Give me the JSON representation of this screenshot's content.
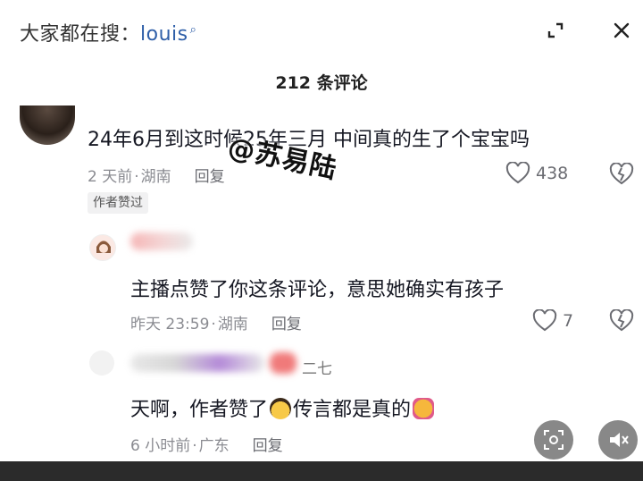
{
  "header": {
    "search_prefix": "大家都在搜：",
    "search_keyword": "louis",
    "expand_icon": "expand-icon",
    "close_icon": "close-icon"
  },
  "comments_title": "212 条评论",
  "comments": [
    {
      "text": "24年6月到这时候25年三月  中间真的生了个宝宝吗",
      "time": "2 天前",
      "location": "湖南",
      "reply_label": "回复",
      "likes": "438",
      "author_tag": "作者赞过"
    },
    {
      "text": "主播点赞了你这条评论，意思她确实有孩子",
      "time": "昨天 23:59",
      "location": "湖南",
      "reply_label": "回复",
      "likes": "7"
    },
    {
      "text_before": "天啊，作者赞了",
      "text_after": "传言都是真的",
      "name_fragment": "二七",
      "time": "6 小时前",
      "location": "广东",
      "reply_label": "回复"
    }
  ],
  "watermark": "@苏易陆",
  "colors": {
    "keyword": "#2f5fa8",
    "meta": "#8a8b91",
    "text": "#161823"
  }
}
